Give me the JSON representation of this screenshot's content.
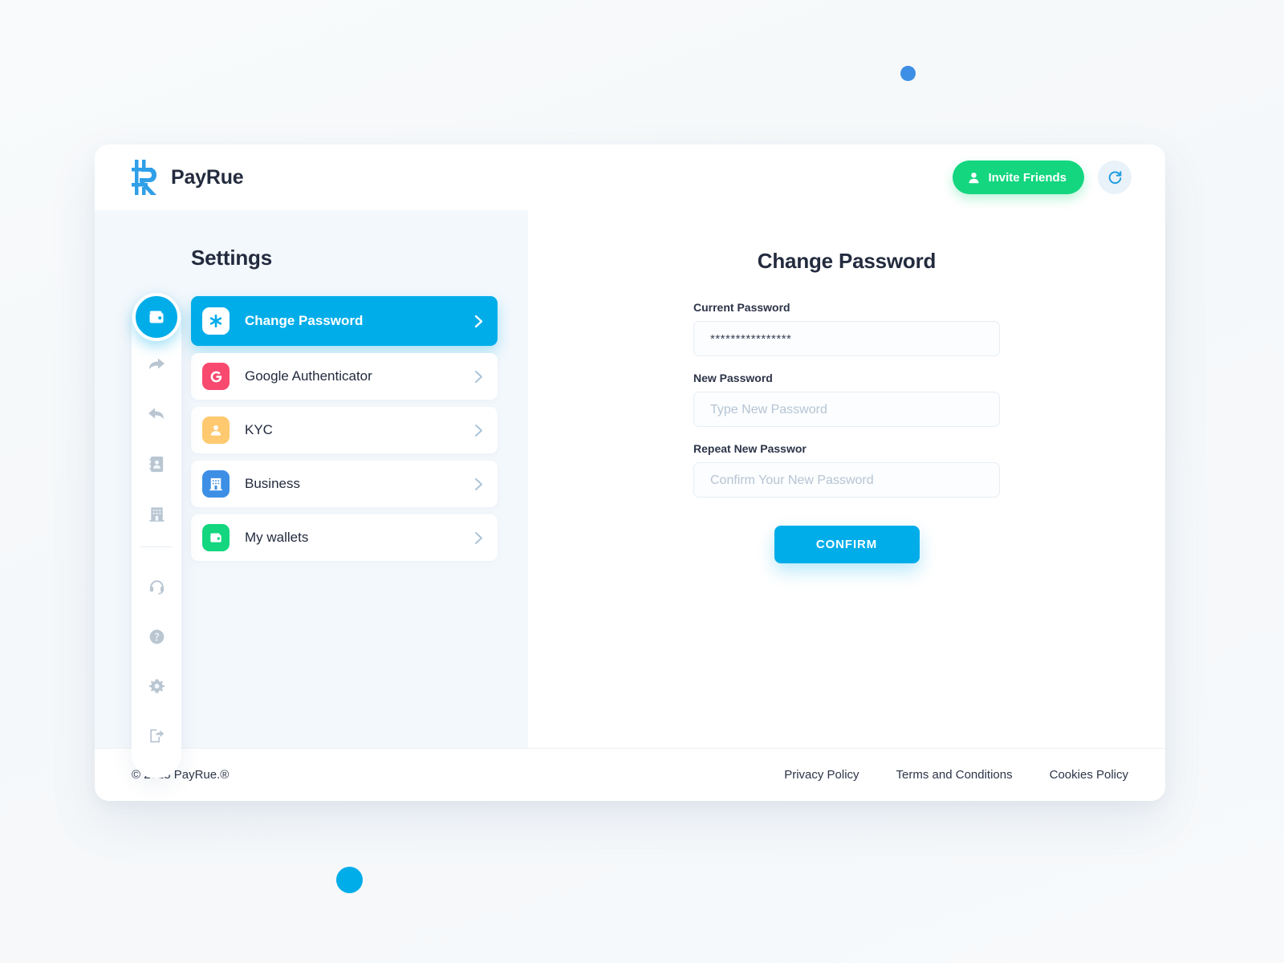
{
  "brand": {
    "name": "PayRue",
    "logo_icon": "payrue-r-logo-icon"
  },
  "topbar": {
    "invite_label": "Invite Friends",
    "invite_icon": "person-icon",
    "invite_color": "#13d67f",
    "refresh_icon": "refresh-icon",
    "refresh_color": "#1f9ce0"
  },
  "rail": {
    "items": [
      {
        "name": "wallet",
        "icon": "wallet-icon",
        "active": true
      },
      {
        "name": "send",
        "icon": "send-arrow-icon",
        "active": false
      },
      {
        "name": "receive",
        "icon": "receive-arrow-icon",
        "active": false
      },
      {
        "name": "contacts",
        "icon": "address-book-icon",
        "active": false
      },
      {
        "name": "business",
        "icon": "building-icon",
        "active": false
      },
      {
        "name": "support",
        "icon": "headset-icon",
        "active": false
      },
      {
        "name": "help",
        "icon": "question-circle-icon",
        "active": false
      },
      {
        "name": "settings",
        "icon": "gear-icon",
        "active": false
      },
      {
        "name": "logout",
        "icon": "logout-icon",
        "active": false
      }
    ]
  },
  "settings": {
    "title": "Settings",
    "items": [
      {
        "label": "Change Password",
        "icon": "asterisk-icon",
        "tile_color": "#ffffff",
        "icon_color": "#00ade9",
        "active": true
      },
      {
        "label": "Google Authenticator",
        "icon": "google-g-icon",
        "tile_color": "#f8496f",
        "icon_color": "#ffffff",
        "active": false
      },
      {
        "label": "KYC",
        "icon": "person-card-icon",
        "tile_color": "#ffc970",
        "icon_color": "#ffffff",
        "active": false
      },
      {
        "label": "Business",
        "icon": "building-icon",
        "tile_color": "#3d8fe5",
        "icon_color": "#ffffff",
        "active": false
      },
      {
        "label": "My wallets",
        "icon": "wallet-icon",
        "tile_color": "#13d67f",
        "icon_color": "#ffffff",
        "active": false
      }
    ],
    "chevron_icon": "chevron-right-icon"
  },
  "form": {
    "title": "Change Password",
    "current_password_label": "Current Password",
    "current_password_value": "****************",
    "new_password_label": "New Password",
    "new_password_value": "",
    "new_password_placeholder": "Type New Password",
    "repeat_password_label": "Repeat New Passwor",
    "repeat_password_value": "",
    "repeat_password_placeholder": "Confirm Your New Password",
    "confirm_label": "CONFIRM",
    "confirm_color": "#00ade9"
  },
  "footer": {
    "copyright": "© 2018 PayRue.®",
    "links": [
      {
        "label": "Privacy Policy"
      },
      {
        "label": "Terms and Conditions"
      },
      {
        "label": "Cookies Policy"
      }
    ]
  },
  "decor": {
    "dot_top_color": "#3d8fe5",
    "dot_bottom_color": "#00ade9"
  }
}
